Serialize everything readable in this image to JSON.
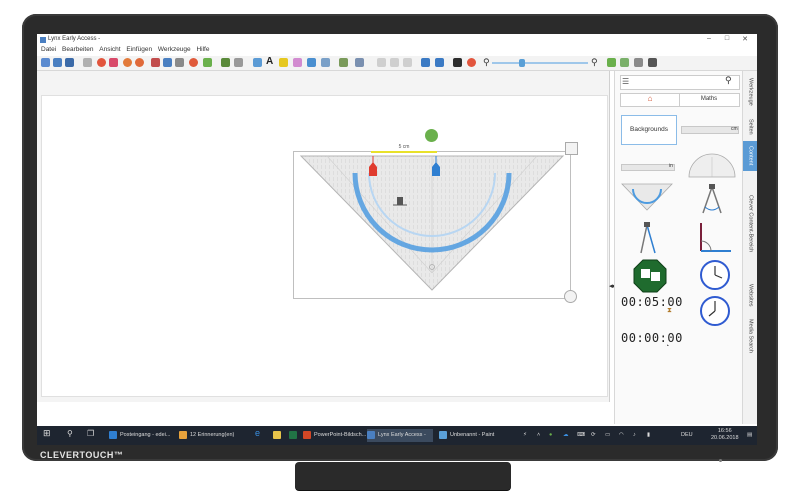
{
  "device": {
    "brand": "CLEVERTOUCH™"
  },
  "window": {
    "title": "Lynx Early Access -",
    "controls": {
      "minimize": "–",
      "maximize": "□",
      "close": "✕"
    }
  },
  "menu": [
    "Datei",
    "Bearbeiten",
    "Ansicht",
    "Einfügen",
    "Werkzeuge",
    "Hilfe"
  ],
  "canvas": {
    "measure_label": "5 cm",
    "object": "set-square-protractor-icon",
    "colors": {
      "red_marker": "#e03b2e",
      "blue_marker": "#2f7fd1",
      "rotate_handle": "#6ab04c",
      "scale_blue": "#4d9be0"
    }
  },
  "panel": {
    "tabs": {
      "home_icon": "home-icon",
      "maths": "Maths"
    },
    "backgrounds": "Backgrounds",
    "ruler_cm": "cm",
    "ruler_in": "in",
    "timer1": "00:05:00",
    "timer2": "00:00:00",
    "nav": {
      "prev": "◀",
      "next": "▶"
    }
  },
  "sidetabs": [
    "Werkzeuge",
    "Seiten",
    "Content",
    "Clever Content-Bereich",
    "Websites",
    "Media Search"
  ],
  "sidetab_active": "Content",
  "taskbar": {
    "items": [
      {
        "label": "Posteingang - edei...",
        "color": "#2f7fd1"
      },
      {
        "label": "12 Erinnerung(en)",
        "color": "#e6a23c"
      },
      {
        "label": "PowerPoint-Bildsch...",
        "color": "#d24726"
      },
      {
        "label": "Lynx Early Access -",
        "color": "#4a7fc1",
        "active": true
      },
      {
        "label": "Unbenannt - Paint",
        "color": "#5aa0d8"
      }
    ],
    "lang": "DEU",
    "time": "16:56",
    "date": "20.06.2018"
  }
}
